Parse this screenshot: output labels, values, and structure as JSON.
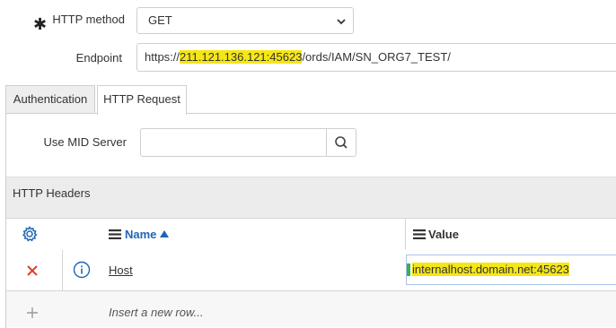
{
  "form": {
    "http_method_label": "HTTP method",
    "http_method_value": "GET",
    "endpoint_label": "Endpoint",
    "endpoint_prefix": "https://",
    "endpoint_host": "211.121.136.121:45623",
    "endpoint_suffix": "/ords/IAM/SN_ORG7_TEST/"
  },
  "tabs": [
    {
      "label": "Authentication",
      "active": false
    },
    {
      "label": "HTTP Request",
      "active": true
    }
  ],
  "mid_server": {
    "label": "Use MID Server",
    "value": ""
  },
  "headers": {
    "title": "HTTP Headers",
    "columns": {
      "name": "Name",
      "value": "Value"
    },
    "rows": [
      {
        "name": "Host",
        "value": "internalhost.domain.net:45623"
      }
    ],
    "insert_placeholder": "Insert a new row..."
  },
  "colors": {
    "highlight": "#f5e616",
    "link_blue": "#1f65b5",
    "delete_red": "#e0402c",
    "edit_green": "#37b24d"
  },
  "icons": [
    "required-asterisk-icon",
    "chevron-down-icon",
    "search-icon",
    "gear-icon",
    "list-icon",
    "sort-up-icon",
    "delete-x-icon",
    "info-icon",
    "plus-icon"
  ]
}
